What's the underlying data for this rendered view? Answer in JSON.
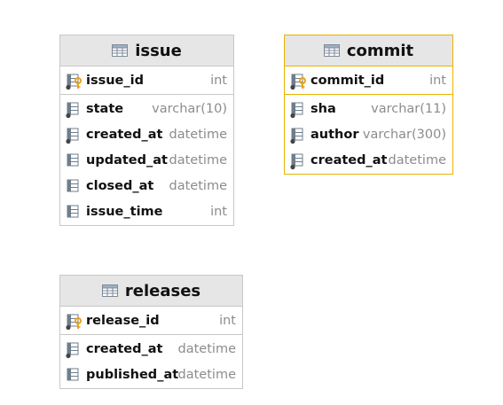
{
  "tables": [
    {
      "name": "issue",
      "pk": {
        "name": "issue_id",
        "type": "int"
      },
      "columns": [
        {
          "name": "state",
          "type": "varchar(10)",
          "icon": "column-not-null"
        },
        {
          "name": "created_at",
          "type": "datetime",
          "icon": "column-not-null"
        },
        {
          "name": "updated_at",
          "type": "datetime",
          "icon": "column"
        },
        {
          "name": "closed_at",
          "type": "datetime",
          "icon": "column"
        },
        {
          "name": "issue_time",
          "type": "int",
          "icon": "column"
        }
      ]
    },
    {
      "name": "commit",
      "selected": true,
      "pk": {
        "name": "commit_id",
        "type": "int"
      },
      "columns": [
        {
          "name": "sha",
          "type": "varchar(11)",
          "icon": "column-not-null"
        },
        {
          "name": "author",
          "type": "varchar(300)",
          "icon": "column-not-null"
        },
        {
          "name": "created_at",
          "type": "datetime",
          "icon": "column-not-null"
        }
      ]
    },
    {
      "name": "releases",
      "pk": {
        "name": "release_id",
        "type": "int"
      },
      "columns": [
        {
          "name": "created_at",
          "type": "datetime",
          "icon": "column-not-null"
        },
        {
          "name": "published_at",
          "type": "datetime",
          "icon": "column"
        }
      ]
    }
  ],
  "colors": {
    "selected_border": "#e8b400",
    "key": "#e8a317",
    "type_text": "#8c8c8c"
  }
}
